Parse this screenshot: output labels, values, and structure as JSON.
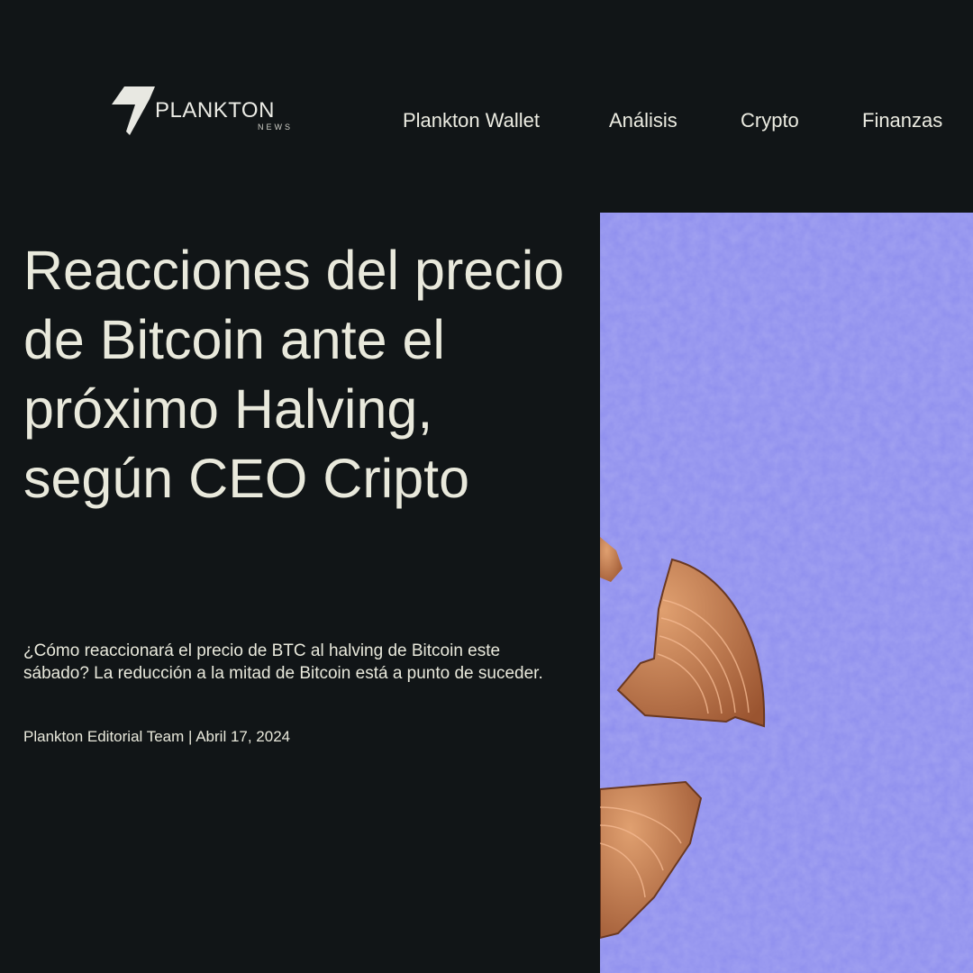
{
  "header": {
    "logo": {
      "name": "PLANKTON",
      "sub": "NEWS"
    },
    "nav": [
      {
        "label": "Plankton Wallet"
      },
      {
        "label": "Análisis"
      },
      {
        "label": "Crypto"
      },
      {
        "label": "Finanzas"
      }
    ]
  },
  "article": {
    "title": "Reacciones del precio de Bitcoin ante el próximo Halving, según CEO Cripto",
    "subtitle": "¿Cómo reaccionará el precio de BTC al halving de Bitcoin este sábado? La reducción a la mitad de Bitcoin está a punto de suceder.",
    "meta": "Plankton Editorial Team | Abril 17, 2024",
    "image": {
      "description_icon": "broken-bitcoin-coins-image",
      "background_color": "#8e8eee",
      "coin_color": "#c97a4a"
    }
  },
  "colors": {
    "background": "#111517",
    "text": "#e9e9dc"
  }
}
